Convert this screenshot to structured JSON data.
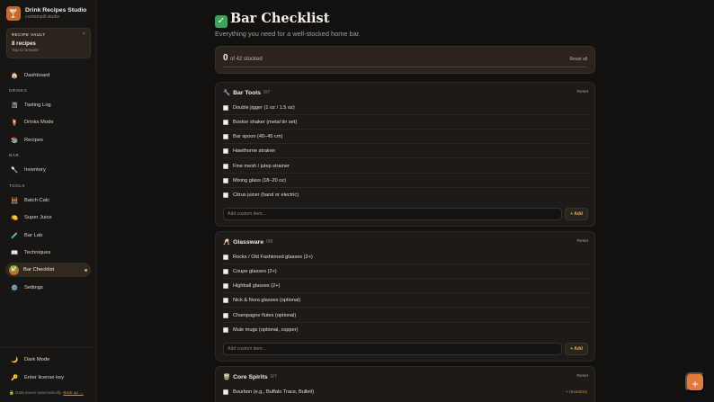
{
  "brand": {
    "name": "Drink Recipes Studio",
    "site": "containpill.studio",
    "logo_icon": "🍸"
  },
  "vault": {
    "title": "RECIPE VAULT",
    "close": "×",
    "count": "8 recipes",
    "hint": "Tap to browse"
  },
  "nav": {
    "dashboard": {
      "label": "Dashboard",
      "icon": "🏠"
    },
    "drinks_label": "DRINKS",
    "drinks": [
      {
        "label": "Tasting Log",
        "icon": "📓"
      },
      {
        "label": "Drinks Mode",
        "icon": "🍹"
      },
      {
        "label": "Recipes",
        "icon": "📚"
      }
    ],
    "bar_label": "BAR",
    "bar": [
      {
        "label": "Inventory",
        "icon": "🥄"
      }
    ],
    "tools_label": "TOOLS",
    "tools": [
      {
        "label": "Batch Calc",
        "icon": "🧮"
      },
      {
        "label": "Super Juice",
        "icon": "🍋"
      },
      {
        "label": "Bar Lab",
        "icon": "🧪"
      },
      {
        "label": "Techniques",
        "icon": "📖"
      },
      {
        "label": "Bar Checklist",
        "icon": "✅"
      },
      {
        "label": "Settings",
        "icon": "⚙️"
      }
    ],
    "dark_mode": {
      "label": "Dark Mode",
      "icon": "🌙"
    },
    "license": {
      "label": "Enter license key",
      "icon": "🔑"
    },
    "footer": {
      "icon": "🔒",
      "text": "Data saves automatically.",
      "link": "Back up →"
    }
  },
  "page": {
    "title_icon": "✓",
    "title": "Bar Checklist",
    "subtitle": "Everything you need for a well-stocked home bar."
  },
  "progress": {
    "count": "0",
    "of_text": "of 42 stocked",
    "reset_all": "Reset all",
    "fraction": 0
  },
  "sections": [
    {
      "icon": "🔧",
      "title": "Bar Tools",
      "count": "0/7",
      "reset": "Reset",
      "items": [
        "Double jigger (1 oz / 1.5 oz)",
        "Boston shaker (metal tin set)",
        "Bar spoon (40–45 cm)",
        "Hawthorne strainer",
        "Fine mesh / julep strainer",
        "Mixing glass (18–20 oz)",
        "Citrus juicer (hand or electric)"
      ],
      "add_placeholder": "Add custom item...",
      "add_label": "+ Add"
    },
    {
      "icon": "🥂",
      "title": "Glassware",
      "count": "0/6",
      "reset": "Reset",
      "items": [
        "Rocks / Old Fashioned glasses (2+)",
        "Coupe glasses (2+)",
        "Highball glasses (2+)",
        "Nick & Nora glasses (optional)",
        "Champagne flutes (optional)",
        "Mule mugs (optional, copper)"
      ],
      "add_placeholder": "Add custom item...",
      "add_label": "+ Add"
    },
    {
      "icon": "🥃",
      "title": "Core Spirits",
      "count": "0/7",
      "reset": "Reset",
      "items": [
        "Bourbon (e.g., Buffalo Trace, Bulleit)"
      ],
      "item_tag": "+ Inventory"
    }
  ],
  "fab": {
    "label": "+"
  }
}
